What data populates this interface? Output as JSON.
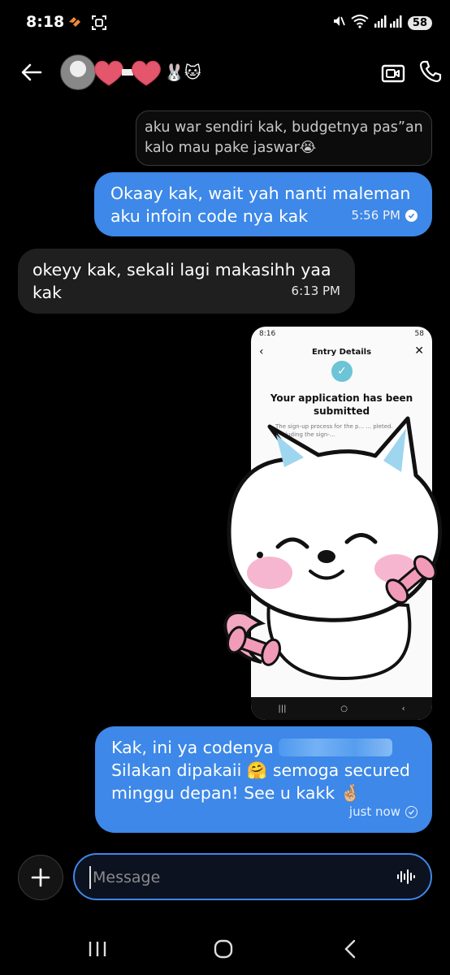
{
  "status_bar": {
    "time": "8:18",
    "battery": "58"
  },
  "header": {
    "contact_emoji": "🐰🐱"
  },
  "messages": {
    "quoted_reply": "aku war sendiri kak, budgetnya pas”an kalo mau pake jaswar😭",
    "out1_text": "Okaay kak, wait yah nanti maleman aku infoin code nya kak",
    "out1_time": "5:56 PM",
    "in1_text": "okeyy kak, sekali lagi makasihh yaa kak",
    "in1_time": "6:13 PM",
    "image_preview": {
      "status_time": "8:16",
      "status_battery": "58",
      "title": "Entry Details",
      "heading": "Your application has been submitted",
      "body": "The sign-up process for the p... ... pleted. Excluding the sign-..."
    },
    "out2_line1": "Kak, ini ya codenya",
    "out2_line2": "Silakan dipakaii 🤗 semoga secured minggu depan! See u kakk 🤞🏼",
    "out2_time": "just now"
  },
  "composer": {
    "placeholder": "Message"
  },
  "colors": {
    "outgoing_bubble": "#3d88e8",
    "incoming_bubble": "#1f1f1f",
    "background": "#000000",
    "input_border": "#3d88e8"
  },
  "icons": [
    "back-arrow-icon",
    "video-call-icon",
    "phone-icon",
    "plus-icon",
    "voice-icon",
    "heart-sticker-icon",
    "checkmark-icon"
  ]
}
